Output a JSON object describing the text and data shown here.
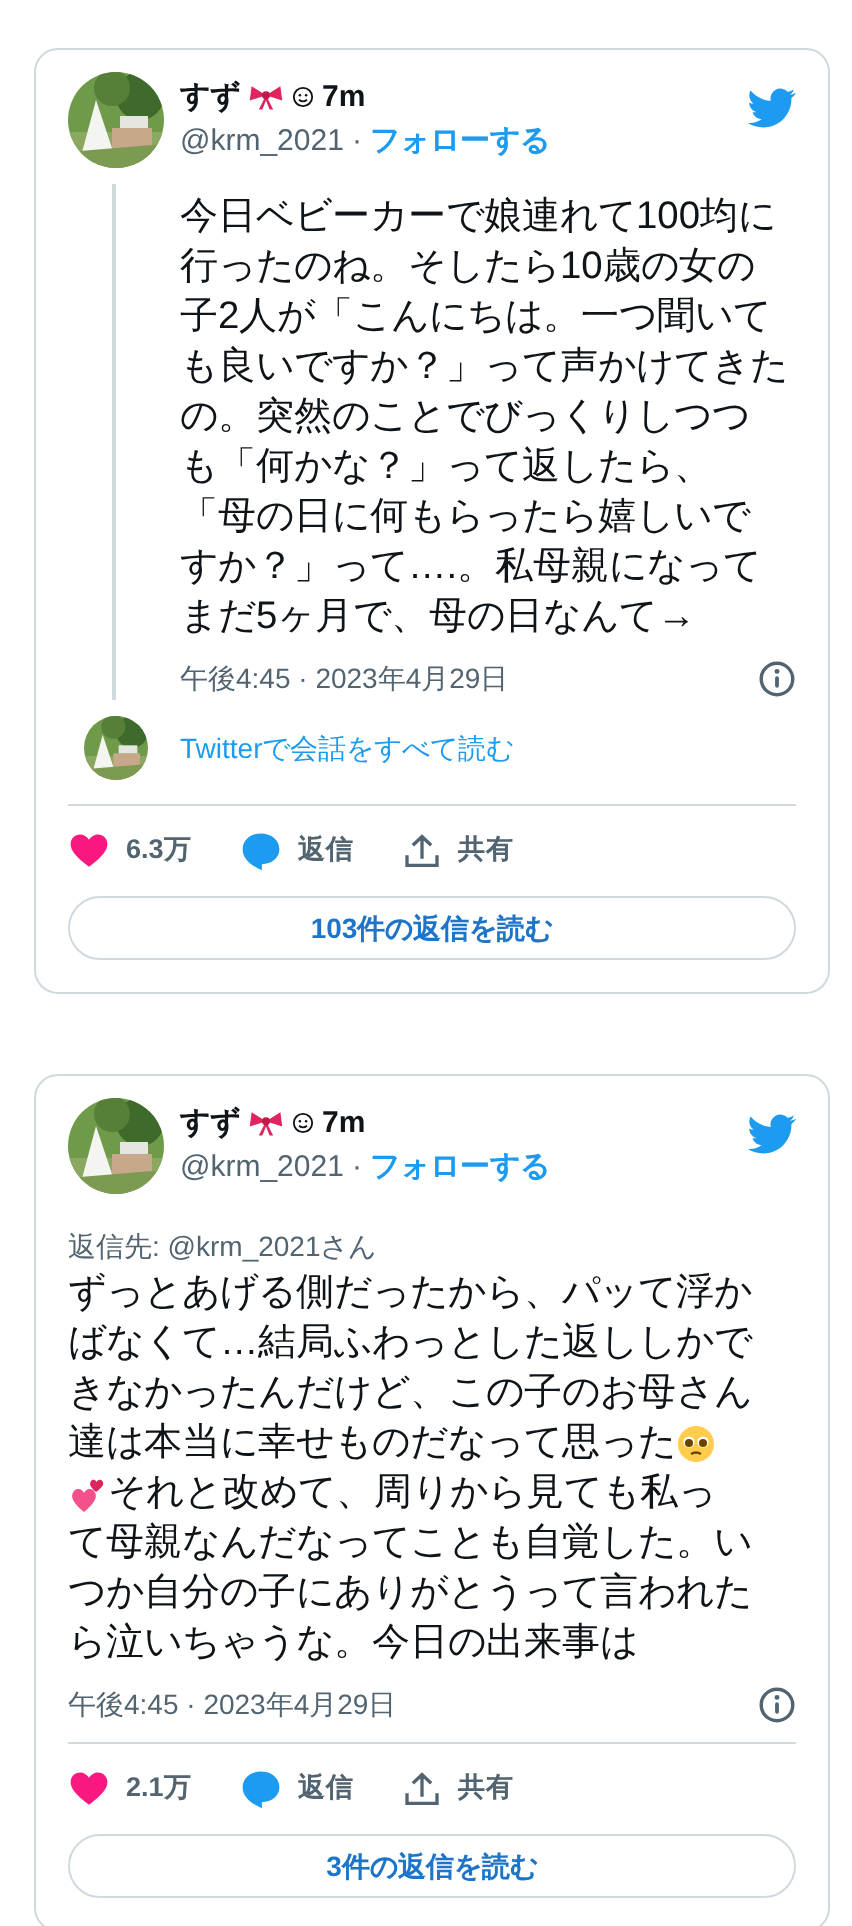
{
  "tweets": [
    {
      "kind": "thread",
      "author": {
        "name": "すず",
        "time": "7m",
        "handle": "@krm_2021",
        "separator": "·",
        "follow": "フォローする"
      },
      "body": [
        [
          {
            "kind": "text",
            "text": "今日ベビーカーで娘連れて100均に"
          }
        ],
        [
          {
            "kind": "text",
            "text": "行ったのね。そしたら10歳の女の"
          }
        ],
        [
          {
            "kind": "text",
            "text": "子2人が「こんにちは。一つ聞いて"
          }
        ],
        [
          {
            "kind": "text",
            "text": "も良いですか？」って声かけてきた"
          }
        ],
        [
          {
            "kind": "text",
            "text": "の。突然のことでびっくりしつつ"
          }
        ],
        [
          {
            "kind": "text",
            "text": "も「何かな？」って返したら、"
          }
        ],
        [
          {
            "kind": "text",
            "text": "「母の日に何もらったら嬉しいで"
          }
        ],
        [
          {
            "kind": "text",
            "text": "すか？」って….。私母親になって"
          }
        ],
        [
          {
            "kind": "text",
            "text": "まだ5ヶ月で、母の日なんて→"
          }
        ]
      ],
      "timestamp": "午後4:45 · 2023年4月29日",
      "conversation": "Twitterで会話をすべて読む",
      "likes": "6.3万",
      "reply": "返信",
      "share": "共有",
      "read_replies": "103件の返信を読む"
    },
    {
      "kind": "reply",
      "author": {
        "name": "すず",
        "time": "7m",
        "handle": "@krm_2021",
        "separator": "·",
        "follow": "フォローする"
      },
      "reply_to": "返信先: @krm_2021さん",
      "body": [
        [
          {
            "kind": "text",
            "text": "ずっとあげる側だったから、パッて浮か"
          }
        ],
        [
          {
            "kind": "text",
            "text": "ばなくて…結局ふわっとした返ししかで"
          }
        ],
        [
          {
            "kind": "text",
            "text": "きなかったんだけど、この子のお母さん"
          }
        ],
        [
          {
            "kind": "text",
            "text": "達は本当に幸せものだなって思った"
          },
          {
            "kind": "pleading-face"
          }
        ],
        [
          {
            "kind": "hearts"
          },
          {
            "kind": "text",
            "text": "それと改めて、周りから見ても私っ"
          }
        ],
        [
          {
            "kind": "text",
            "text": "て母親なんだなってことも自覚した。い"
          }
        ],
        [
          {
            "kind": "text",
            "text": "つか自分の子にありがとうって言われた"
          }
        ],
        [
          {
            "kind": "text",
            "text": "ら泣いちゃうな。今日の出来事は"
          }
        ]
      ],
      "timestamp": "午後4:45 · 2023年4月29日",
      "likes": "2.1万",
      "reply": "返信",
      "share": "共有",
      "read_replies": "3件の返信を読む"
    }
  ]
}
